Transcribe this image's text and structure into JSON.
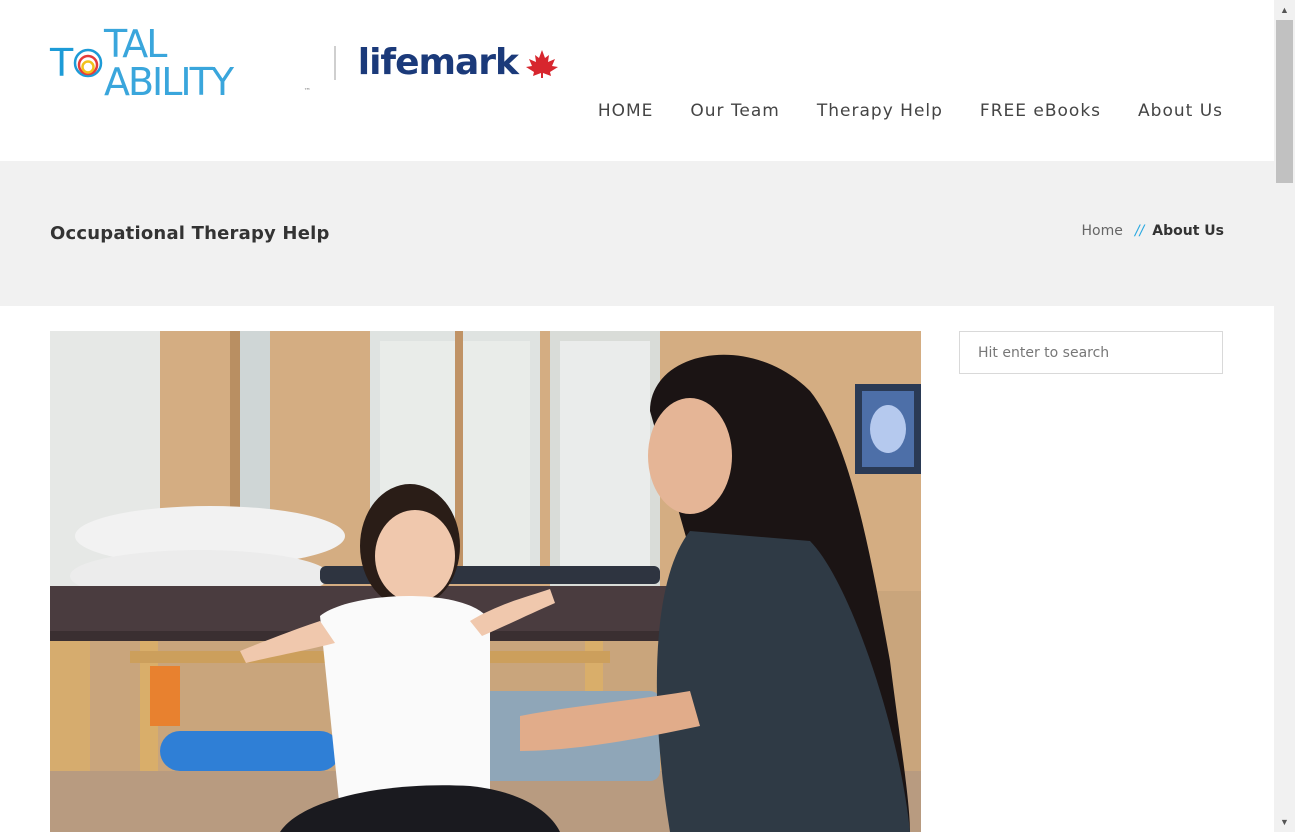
{
  "brand": {
    "logo_primary": "TOTAL ABILITY",
    "logo_primary_start": "T",
    "logo_primary_end": "TAL ABILITY",
    "logo_tm": "™",
    "logo_secondary": "lifemark"
  },
  "nav": {
    "items": [
      {
        "label": "HOME"
      },
      {
        "label": "Our Team"
      },
      {
        "label": "Therapy Help"
      },
      {
        "label": "FREE eBooks"
      },
      {
        "label": "About Us"
      }
    ]
  },
  "titlebar": {
    "title": "Occupational Therapy Help",
    "breadcrumb": {
      "home": "Home",
      "separator": "//",
      "current": "About Us"
    }
  },
  "sidebar": {
    "search": {
      "placeholder": "Hit enter to search",
      "value": ""
    }
  },
  "colors": {
    "accent": "#29a8e0",
    "brand_navy": "#1b3a7a",
    "brand_red": "#d7262e",
    "titlebar_bg": "#f1f1f1"
  },
  "icons": {
    "logo_ring": "concentric-rings-icon",
    "logo_leaf": "maple-leaf-icon",
    "scroll_up": "chevron-up-icon",
    "scroll_down": "chevron-down-icon"
  }
}
